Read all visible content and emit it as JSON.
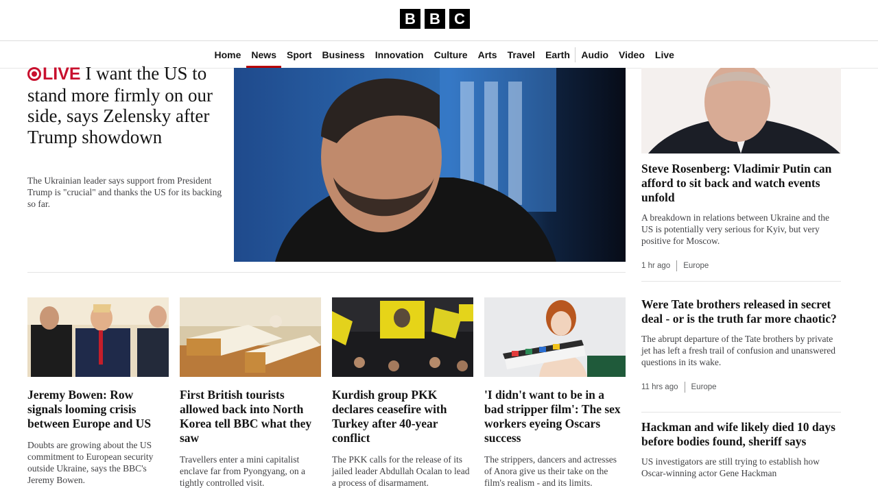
{
  "brand": {
    "letters": [
      "B",
      "B",
      "C"
    ]
  },
  "nav": {
    "items": [
      "Home",
      "News",
      "Sport",
      "Business",
      "Innovation",
      "Culture",
      "Arts",
      "Travel",
      "Earth",
      "Audio",
      "Video",
      "Live"
    ],
    "active": "News"
  },
  "lead": {
    "live_label": "LIVE",
    "title": "I want the US to stand more firmly on our side, says Zelensky after Trump showdown",
    "summary": "The Ukrainian leader says support from President Trump is \"crucial\" and thanks the US for its backing so far."
  },
  "cards": [
    {
      "title": "Jeremy Bowen: Row signals looming crisis between Europe and US",
      "summary": "Doubts are growing about the US commitment to European security outside Ukraine, says the BBC's Jeremy Bowen."
    },
    {
      "title": "First British tourists allowed back into North Korea tell BBC what they saw",
      "summary": "Travellers enter a mini capitalist enclave far from Pyongyang, on a tightly controlled visit."
    },
    {
      "title": "Kurdish group PKK declares ceasefire with Turkey after 40-year conflict",
      "summary": "The PKK calls for the release of its jailed leader Abdullah Ocalan to lead a process of disarmament."
    },
    {
      "title": "'I didn't want to be in a bad stripper film': The sex workers eyeing Oscars success",
      "summary": "The strippers, dancers and actresses of Anora give us their take on the film's realism - and its limits."
    }
  ],
  "right": [
    {
      "title": "Steve Rosenberg: Vladimir Putin can afford to sit back and watch events unfold",
      "summary": "A breakdown in relations between Ukraine and the US is potentially very serious for Kyiv, but very positive for Moscow.",
      "time": "1 hr ago",
      "section": "Europe"
    },
    {
      "title": "Were Tate brothers released in secret deal - or is the truth far more chaotic?",
      "summary": "The abrupt departure of the Tate brothers by private jet has left a fresh trail of confusion and unanswered questions in its wake.",
      "time": "11 hrs ago",
      "section": "Europe"
    },
    {
      "title": "Hackman and wife likely died 10 days before bodies found, sheriff says",
      "summary": "US investigators are still trying to establish how Oscar-winning actor Gene Hackman"
    }
  ],
  "colors": {
    "live_red": "#c8102e",
    "active_underline": "#b80000",
    "brand_block": "#000000"
  }
}
